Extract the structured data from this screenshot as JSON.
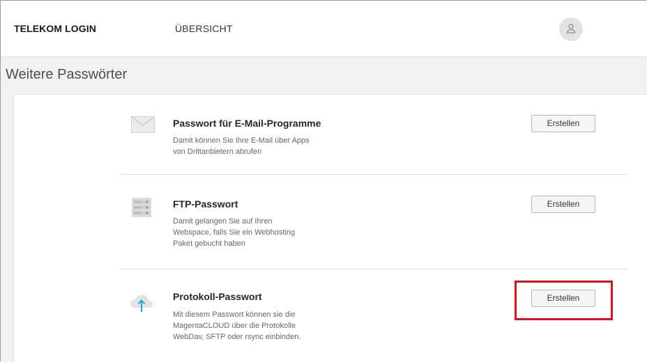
{
  "header": {
    "brand": "TELEKOM LOGIN",
    "nav_overview": "ÜBERSICHT",
    "avatar_icon": "user-icon"
  },
  "page": {
    "title": "Weitere Passwörter"
  },
  "items": [
    {
      "icon": "envelope-icon",
      "title": "Passwort für E-Mail-Programme",
      "desc_lines": [
        "Damit können Sie Ihre E-Mail über Apps",
        "von Drittanbietern abrufen"
      ],
      "button": "Erstellen"
    },
    {
      "icon": "server-icon",
      "title": "FTP-Passwort",
      "desc_lines": [
        "Damit gelangen Sie auf Ihren",
        "Webspace, falls Sie ein Webhosting",
        "Paket gebucht haben"
      ],
      "button": "Erstellen"
    },
    {
      "icon": "cloud-upload-icon",
      "title": "Protokoll-Passwort",
      "desc_lines": [
        "Mit diesem Passwort können sie die",
        "MagentaCLOUD über die Protokolle",
        "WebDav, SFTP oder rsync einbinden."
      ],
      "button": "Erstellen"
    }
  ],
  "colors": {
    "highlight": "#e2101a",
    "cloud_arrow": "#2aa1d8"
  }
}
